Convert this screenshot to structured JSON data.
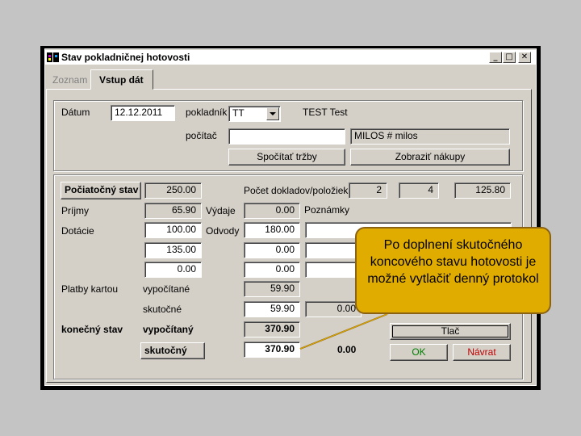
{
  "window": {
    "title": "Stav pokladničnej hotovosti",
    "controls": {
      "minimize": "_",
      "maximize": "□",
      "close": "✕"
    }
  },
  "tabs": [
    {
      "label": "Zoznam",
      "active": false
    },
    {
      "label": "Vstup dát",
      "active": true
    }
  ],
  "header": {
    "datum_label": "Dátum",
    "datum_value": "12.12.2011",
    "pokladnik_label": "pokladník",
    "pokladnik_value": "TT",
    "pokladnik_name": "TEST Test",
    "pocitac_label": "počítač",
    "pocitac_value": "",
    "pocitac_name": "MILOS # milos",
    "spocitat_button": "Spočítať tržby",
    "zobrazit_button": "Zobraziť nákupy"
  },
  "main": {
    "pociatocny_button": "Počiatočný stav",
    "pociatocny_value": "250.00",
    "pocet_label": "Počet dokladov/položiek",
    "pocet_values": [
      "2",
      "4",
      "125.80"
    ],
    "prijmy_label": "Príjmy",
    "prijmy_value": "65.90",
    "vydaje_label": "Výdaje",
    "vydaje_value": "0.00",
    "poznamky_label": "Poznámky",
    "dotacie_label": "Dotácie",
    "dotacie_value": "100.00",
    "odvody_label": "Odvody",
    "odvody_value": "180.00",
    "row3_left": "135.00",
    "row3_right": "0.00",
    "row4_left": "0.00",
    "row4_right": "0.00",
    "platby_label": "Platby kartou",
    "vypocitane_label": "vypočítané",
    "vypocitane_value": "59.90",
    "skutocne_label": "skutočné",
    "skutocne_value": "59.90",
    "skutocne_diff": "0.00",
    "konecny_label": "konečný stav",
    "vypocitany_label": "vypočítaný",
    "vypocitany_value": "370.90",
    "skutocny_button": "skutočný",
    "skutocny_value": "370.90",
    "skutocny_diff": "0.00",
    "tlac_button": "Tlač",
    "ok_button": "OK",
    "navrat_button": "Návrat"
  },
  "callout": {
    "text": "Po doplnení skutočného koncového stavu hotovosti je možné vytlačiť denný protokol"
  },
  "colors": {
    "callout_bg": "#e0ac00",
    "callout_border": "#8b6212",
    "ok_green": "#008000",
    "navrat_red": "#c00000",
    "dialog_face": "#d4d0c8"
  }
}
